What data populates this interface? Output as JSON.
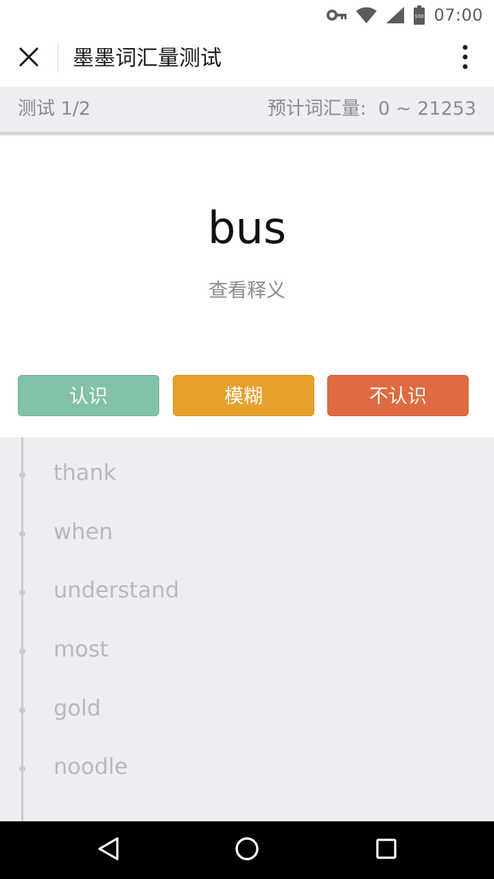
{
  "status_bar": {
    "time": "07:00",
    "icons": [
      "key-icon",
      "wifi-icon",
      "signal-icon",
      "battery-icon"
    ],
    "battery_label": "100"
  },
  "app_bar": {
    "title": "墨墨词汇量测试",
    "close_icon": "close-icon",
    "more_icon": "more-vert-icon"
  },
  "progress": {
    "test_label": "测试 1/2",
    "estimate_label": "预计词汇量:  0 ~ 21253"
  },
  "card": {
    "word": "bus",
    "reveal_label": "查看释义"
  },
  "buttons": {
    "know": "认识",
    "fuzzy": "模糊",
    "unknown": "不认识"
  },
  "colors": {
    "know": "#82c2a8",
    "fuzzy": "#e8a02c",
    "unknown": "#e06a3f",
    "background": "#ededf2"
  },
  "history": {
    "items": [
      {
        "word": "thank"
      },
      {
        "word": "when"
      },
      {
        "word": "understand"
      },
      {
        "word": "most"
      },
      {
        "word": "gold"
      },
      {
        "word": "noodle"
      }
    ]
  },
  "nav_bar": {
    "icons": [
      "back-icon",
      "home-icon",
      "recents-icon"
    ]
  }
}
